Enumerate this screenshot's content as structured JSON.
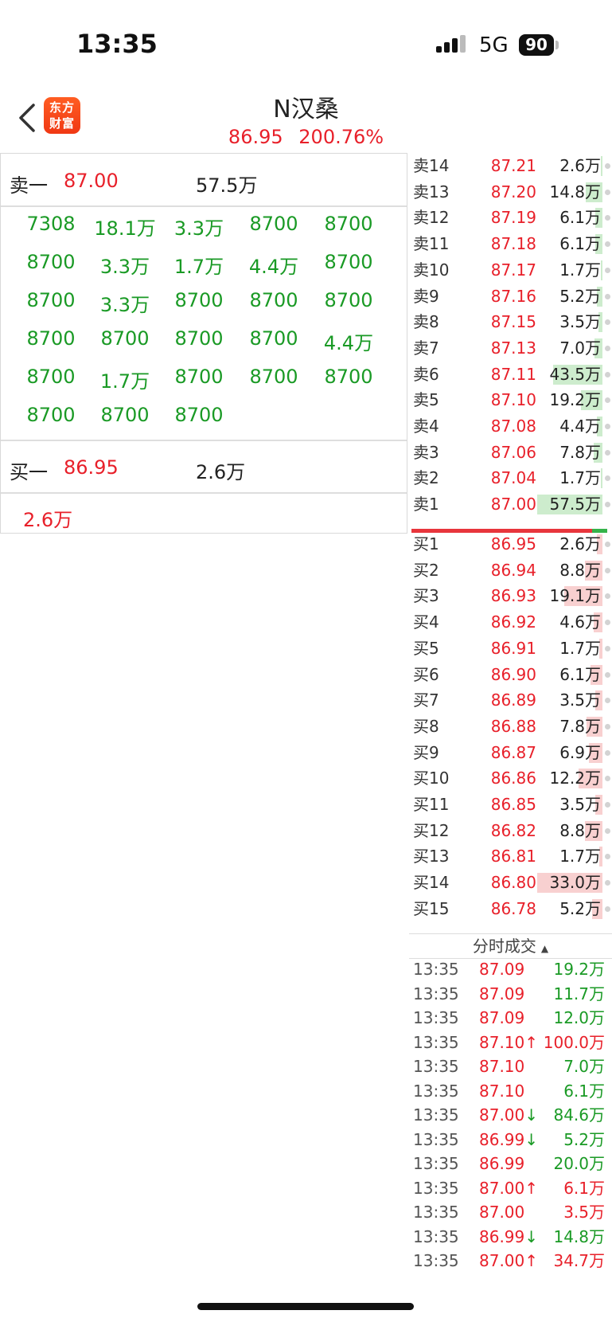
{
  "status": {
    "time": "13:35",
    "network": "5G",
    "battery": "90"
  },
  "header": {
    "logo_line1": "东方",
    "logo_line2": "财富",
    "title": "N汉桑",
    "price": "86.95",
    "change_pct": "200.76%"
  },
  "left_panel": {
    "sell_label": "卖一",
    "sell_price": "87.00",
    "sell_volume": "57.5万",
    "ticks": [
      "7308",
      "18.1万",
      "3.3万",
      "8700",
      "8700",
      "8700",
      "3.3万",
      "1.7万",
      "4.4万",
      "8700",
      "8700",
      "3.3万",
      "8700",
      "8700",
      "8700",
      "8700",
      "8700",
      "8700",
      "8700",
      "4.4万",
      "8700",
      "1.7万",
      "8700",
      "8700",
      "8700",
      "8700",
      "8700",
      "8700"
    ],
    "buy_label": "买一",
    "buy_price": "86.95",
    "buy_volume": "2.6万",
    "buy_queue": "2.6万"
  },
  "order_book": {
    "asks": [
      {
        "name": "卖14",
        "price": "87.21",
        "vol": "2.6万",
        "level": 0.02
      },
      {
        "name": "卖13",
        "price": "87.20",
        "vol": "14.8万",
        "level": 0.26
      },
      {
        "name": "卖12",
        "price": "87.19",
        "vol": "6.1万",
        "level": 0.11
      },
      {
        "name": "卖11",
        "price": "87.18",
        "vol": "6.1万",
        "level": 0.11
      },
      {
        "name": "卖10",
        "price": "87.17",
        "vol": "1.7万",
        "level": 0.03
      },
      {
        "name": "卖9",
        "price": "87.16",
        "vol": "5.2万",
        "level": 0.09
      },
      {
        "name": "卖8",
        "price": "87.15",
        "vol": "3.5万",
        "level": 0.06
      },
      {
        "name": "卖7",
        "price": "87.13",
        "vol": "7.0万",
        "level": 0.12
      },
      {
        "name": "卖6",
        "price": "87.11",
        "vol": "43.5万",
        "level": 0.76
      },
      {
        "name": "卖5",
        "price": "87.10",
        "vol": "19.2万",
        "level": 0.33
      },
      {
        "name": "卖4",
        "price": "87.08",
        "vol": "4.4万",
        "level": 0.08
      },
      {
        "name": "卖3",
        "price": "87.06",
        "vol": "7.8万",
        "level": 0.14
      },
      {
        "name": "卖2",
        "price": "87.04",
        "vol": "1.7万",
        "level": 0.03
      },
      {
        "name": "卖1",
        "price": "87.00",
        "vol": "57.5万",
        "level": 1.0
      }
    ],
    "bids": [
      {
        "name": "买1",
        "price": "86.95",
        "vol": "2.6万",
        "level": 0.08
      },
      {
        "name": "买2",
        "price": "86.94",
        "vol": "8.8万",
        "level": 0.27
      },
      {
        "name": "买3",
        "price": "86.93",
        "vol": "19.1万",
        "level": 0.58
      },
      {
        "name": "买4",
        "price": "86.92",
        "vol": "4.6万",
        "level": 0.14
      },
      {
        "name": "买5",
        "price": "86.91",
        "vol": "1.7万",
        "level": 0.05
      },
      {
        "name": "买6",
        "price": "86.90",
        "vol": "6.1万",
        "level": 0.18
      },
      {
        "name": "买7",
        "price": "86.89",
        "vol": "3.5万",
        "level": 0.11
      },
      {
        "name": "买8",
        "price": "86.88",
        "vol": "7.8万",
        "level": 0.24
      },
      {
        "name": "买9",
        "price": "86.87",
        "vol": "6.9万",
        "level": 0.21
      },
      {
        "name": "买10",
        "price": "86.86",
        "vol": "12.2万",
        "level": 0.37
      },
      {
        "name": "买11",
        "price": "86.85",
        "vol": "3.5万",
        "level": 0.11
      },
      {
        "name": "买12",
        "price": "86.82",
        "vol": "8.8万",
        "level": 0.27
      },
      {
        "name": "买13",
        "price": "86.81",
        "vol": "1.7万",
        "level": 0.05
      },
      {
        "name": "买14",
        "price": "86.80",
        "vol": "33.0万",
        "level": 1.0
      },
      {
        "name": "买15",
        "price": "86.78",
        "vol": "5.2万",
        "level": 0.16
      }
    ]
  },
  "trades": {
    "header": "分时成交",
    "rows": [
      {
        "time": "13:35",
        "price": "87.09",
        "vol": "19.2万",
        "dir": "",
        "pc": "red",
        "vc": "green"
      },
      {
        "time": "13:35",
        "price": "87.09",
        "vol": "11.7万",
        "dir": "",
        "pc": "red",
        "vc": "green"
      },
      {
        "time": "13:35",
        "price": "87.09",
        "vol": "12.0万",
        "dir": "",
        "pc": "red",
        "vc": "green"
      },
      {
        "time": "13:35",
        "price": "87.10↑",
        "vol": "100.0万",
        "dir": "up",
        "pc": "red",
        "vc": "red"
      },
      {
        "time": "13:35",
        "price": "87.10",
        "vol": "7.0万",
        "dir": "",
        "pc": "red",
        "vc": "green"
      },
      {
        "time": "13:35",
        "price": "87.10",
        "vol": "6.1万",
        "dir": "",
        "pc": "red",
        "vc": "green"
      },
      {
        "time": "13:35",
        "price": "87.00↓",
        "vol": "84.6万",
        "dir": "down",
        "pc": "red",
        "vc": "green"
      },
      {
        "time": "13:35",
        "price": "86.99↓",
        "vol": "5.2万",
        "dir": "down",
        "pc": "red",
        "vc": "green"
      },
      {
        "time": "13:35",
        "price": "86.99",
        "vol": "20.0万",
        "dir": "",
        "pc": "red",
        "vc": "green"
      },
      {
        "time": "13:35",
        "price": "87.00↑",
        "vol": "6.1万",
        "dir": "up",
        "pc": "red",
        "vc": "red"
      },
      {
        "time": "13:35",
        "price": "87.00",
        "vol": "3.5万",
        "dir": "",
        "pc": "red",
        "vc": "red"
      },
      {
        "time": "13:35",
        "price": "86.99↓",
        "vol": "14.8万",
        "dir": "down",
        "pc": "red",
        "vc": "green"
      },
      {
        "time": "13:35",
        "price": "87.00↑",
        "vol": "34.7万",
        "dir": "up",
        "pc": "red",
        "vc": "red"
      }
    ]
  },
  "colors": {
    "up": "#e8202a",
    "down": "#1a9a25",
    "ask_bar": "#cdeccd",
    "bid_bar": "#f8d0d0"
  }
}
